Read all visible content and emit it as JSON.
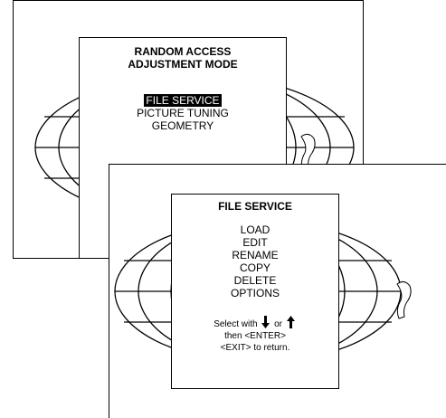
{
  "back_screen": {
    "title_line1": "RANDOM ACCESS",
    "title_line2": "ADJUSTMENT MODE",
    "items": [
      {
        "label": "FILE SERVICE",
        "selected": true
      },
      {
        "label": "PICTURE TUNING",
        "selected": false
      },
      {
        "label": "GEOMETRY",
        "selected": false
      }
    ]
  },
  "front_screen": {
    "title": "FILE SERVICE",
    "items": [
      {
        "label": "LOAD"
      },
      {
        "label": "EDIT"
      },
      {
        "label": "RENAME"
      },
      {
        "label": "COPY"
      },
      {
        "label": "DELETE"
      },
      {
        "label": "OPTIONS"
      }
    ],
    "hint": {
      "select_prefix": "Select with",
      "or_text": "or",
      "line2": "then <ENTER>",
      "line3": "<EXIT> to return."
    }
  },
  "icons": {
    "down": "down-arrow-icon",
    "up": "up-arrow-icon",
    "background": "globe-icon"
  }
}
